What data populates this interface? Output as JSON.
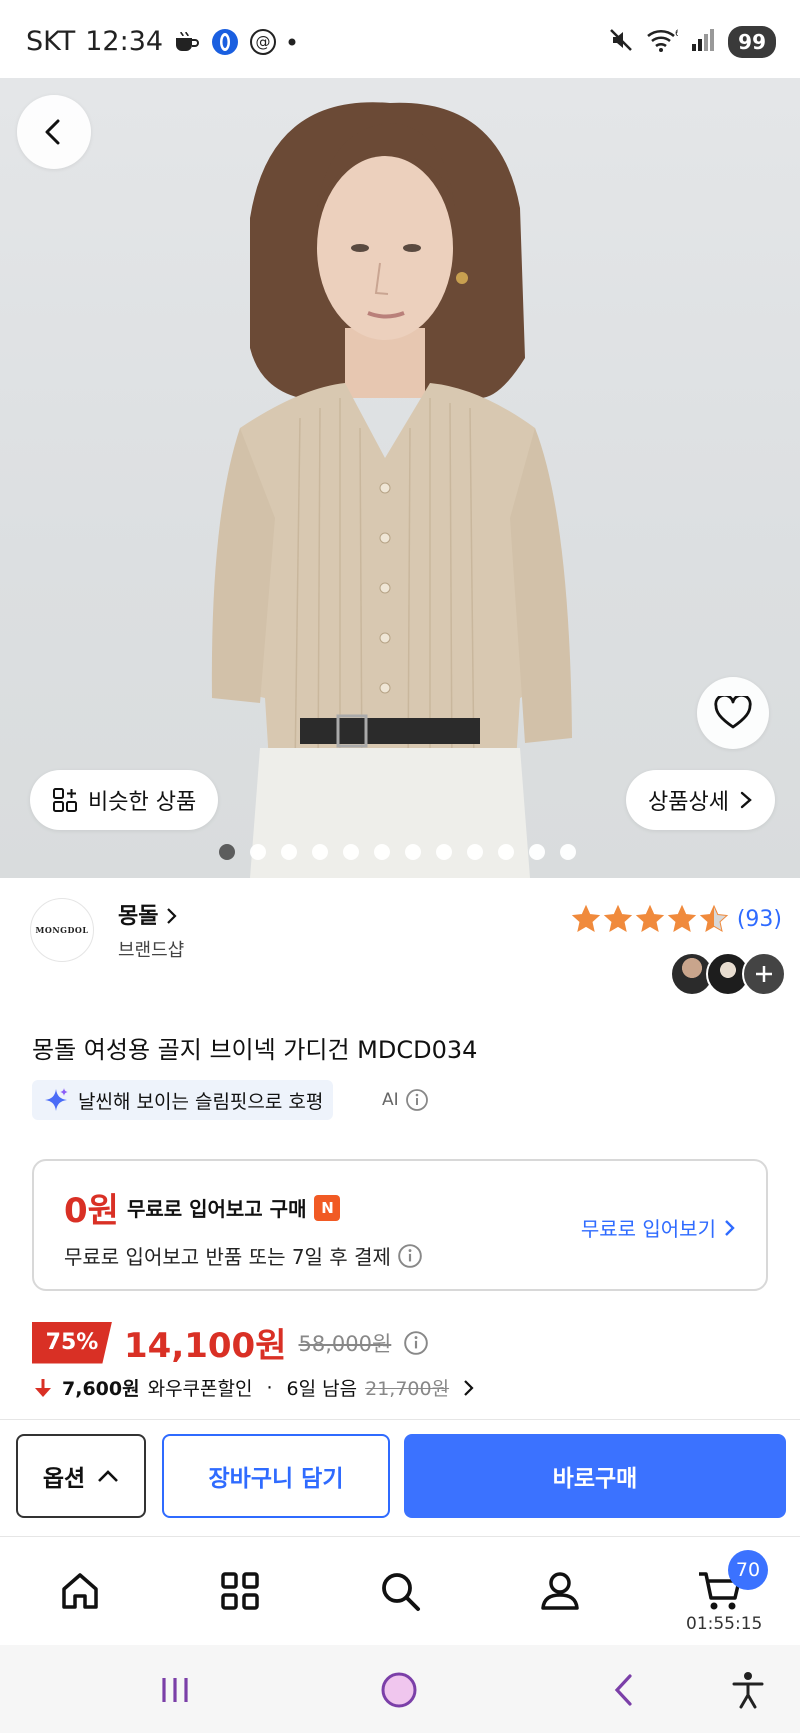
{
  "status_bar": {
    "carrier": "SKT",
    "time": "12:34",
    "battery": "99"
  },
  "hero": {
    "back_icon": "chevron-left-icon",
    "wishlist_icon": "heart-icon",
    "similar_label": "비슷한 상품",
    "detail_label": "상품상세",
    "dots_total": 12,
    "dots_active": 1
  },
  "brand": {
    "logo_text": "MONGDOL",
    "name": "몽돌",
    "shop_label": "브랜드샵",
    "rating_stars": 4.5,
    "review_count": "(93)"
  },
  "product": {
    "title": "몽돌 여성용 골지 브이넥 가디건 MDCD034",
    "ai_summary": "날씬해 보이는 슬림핏으로 호평",
    "ai_label": "AI"
  },
  "try_free": {
    "zero_price": "0원",
    "headline": "무료로 입어보고 구매",
    "badge": "N",
    "subtext": "무료로 입어보고 반품 또는 7일 후 결제",
    "link_label": "무료로 입어보기"
  },
  "price": {
    "discount": "75%",
    "sale_price": "14,100원",
    "original_price": "58,000원",
    "coupon_amount": "7,600원",
    "coupon_label": "와우쿠폰할인",
    "separator": "·",
    "days_left": "6일 남음",
    "coupon_original": "21,700원"
  },
  "actions": {
    "option_label": "옵션",
    "cart_label": "장바구니 담기",
    "buy_label": "바로구매"
  },
  "bottom_nav": {
    "cart_count": "70",
    "cart_timer": "01:55:15"
  },
  "colors": {
    "accent_blue": "#3b72ff",
    "sale_red": "#d93025",
    "star_orange": "#f08a3c"
  }
}
